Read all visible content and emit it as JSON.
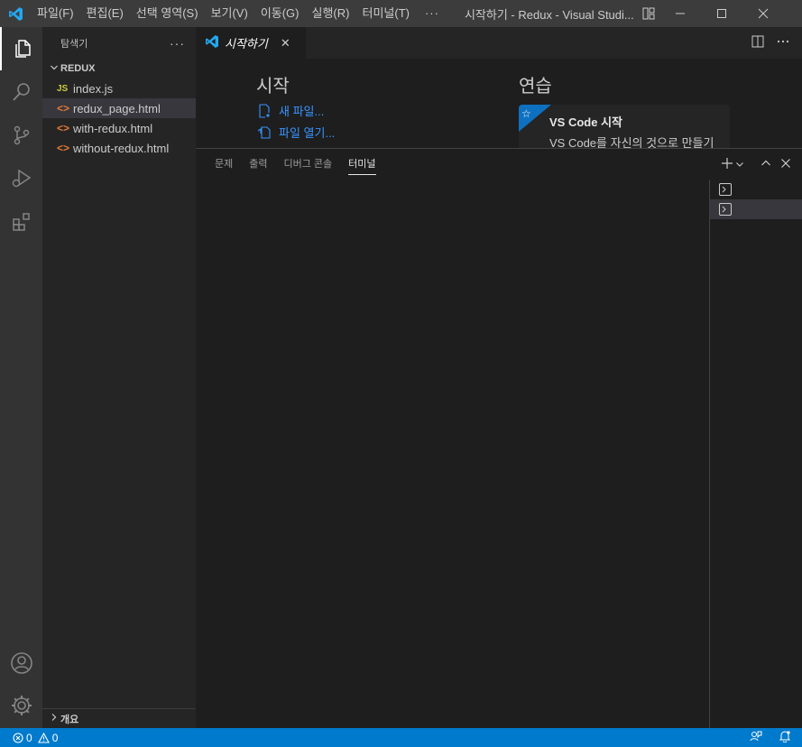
{
  "window": {
    "title": "시작하기 - Redux - Visual Studi...",
    "app_icon": "vscode-logo-icon"
  },
  "menu": {
    "items": [
      "파일(F)",
      "편집(E)",
      "선택 영역(S)",
      "보기(V)",
      "이동(G)",
      "실행(R)",
      "터미널(T)"
    ],
    "more": "···"
  },
  "activity_bar": {
    "items": [
      "explorer-icon",
      "search-icon",
      "source-control-icon",
      "run-debug-icon",
      "extensions-icon"
    ],
    "bottom": [
      "account-icon",
      "settings-gear-icon"
    ]
  },
  "sidebar": {
    "title": "탐색기",
    "more": "···",
    "folder": "REDUX",
    "files": [
      {
        "icon": "JS",
        "name": "index.js",
        "type": "js"
      },
      {
        "icon": "<>",
        "name": "redux_page.html",
        "type": "html"
      },
      {
        "icon": "<>",
        "name": "with-redux.html",
        "type": "html"
      },
      {
        "icon": "<>",
        "name": "without-redux.html",
        "type": "html"
      }
    ],
    "outline": "개요"
  },
  "editor": {
    "tab_label": "시작하기",
    "tab_close": "✕",
    "welcome": {
      "start_heading": "시작",
      "new_file": "새 파일...",
      "open_file": "파일 열기...",
      "walkthrough_heading": "연습",
      "card_title": "VS Code 시작",
      "card_desc": "VS Code를 자신의 것으로 만들기"
    }
  },
  "panel": {
    "tabs": [
      "문제",
      "출력",
      "디버그 콘솔",
      "터미널"
    ],
    "active_tab": "터미널"
  },
  "statusbar": {
    "errors": "0",
    "warnings": "0"
  },
  "colors": {
    "accent": "#007acc",
    "link": "#3794ff",
    "titlebar": "#3c3c3c",
    "activitybar": "#333333",
    "sidebar": "#252526",
    "editor": "#1e1e1e"
  }
}
